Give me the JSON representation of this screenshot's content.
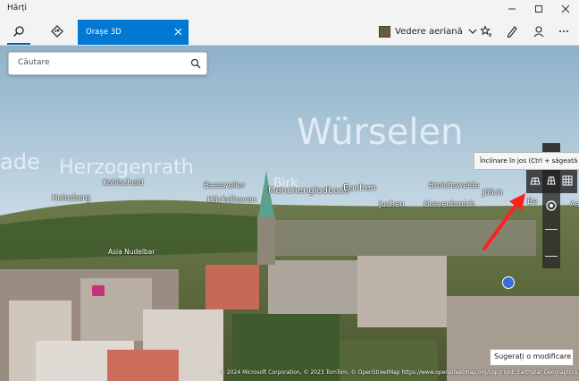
{
  "window": {
    "title": "Hărți"
  },
  "toolbar": {
    "tab3d_label": "Orașe 3D",
    "aerial_label": "Vedere aeriană"
  },
  "search": {
    "placeholder": "Căutare"
  },
  "map": {
    "big_labels": [
      "Würselen",
      "Herzogenrath",
      "ade"
    ],
    "places": [
      "Heinsberg",
      "Baesweiler",
      "Hückelhoven",
      "Mönchengladbach",
      "Euchen",
      "Broichsweide",
      "Jülich",
      "Juchen",
      "Grevenbroich",
      "Kohlscheid",
      "Birk",
      "Asia Nudelbar",
      "Aa",
      "Be"
    ]
  },
  "tooltip": {
    "text": "Înclinare în jos (Ctrl + săgeată în jos)"
  },
  "feedback": {
    "label": "Sugerați o modificare"
  },
  "copyright": "© 2024 Microsoft Corporation, © 2023 TomTom, © OpenStreetMap https://www.openstreetmap.org/copyright, Earthstar Geographics SIO",
  "colors": {
    "accent": "#0078d4",
    "annotation_arrow": "#ff2020"
  }
}
